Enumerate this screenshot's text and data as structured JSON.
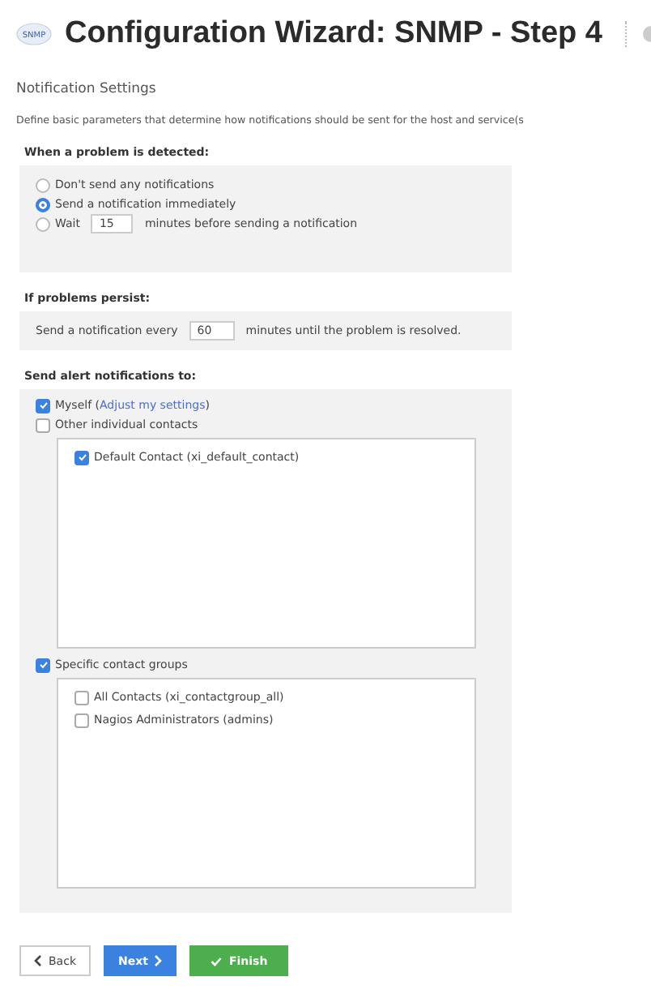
{
  "header": {
    "logo": "SNMP",
    "title": "Configuration Wizard: SNMP - Step 4"
  },
  "section_title": "Notification Settings",
  "description": "Define basic parameters that determine how notifications should be sent for the host and service(s",
  "problem_detected": {
    "heading": "When a problem is detected:",
    "options": [
      {
        "kind": "text",
        "label": "Don't send any notifications",
        "selected": false
      },
      {
        "kind": "text",
        "label": "Send a notification immediately",
        "selected": true
      },
      {
        "kind": "wait",
        "before": "Wait",
        "value": "15",
        "after": "minutes before sending a notification",
        "selected": false
      }
    ]
  },
  "problems_persist": {
    "heading": "If problems persist:",
    "before": "Send a notification every",
    "value": "60",
    "after": "minutes until the problem is resolved."
  },
  "alerts": {
    "heading": "Send alert notifications to:",
    "myself": {
      "label": "Myself (",
      "link": "Adjust my settings",
      "suffix": ")",
      "checked": true
    },
    "groups": [
      {
        "label": "Other individual contacts",
        "checked": false,
        "items": [
          {
            "label": "Default Contact (xi_default_contact)",
            "checked": true
          }
        ]
      },
      {
        "label": "Specific contact groups",
        "checked": true,
        "items": [
          {
            "label": "All Contacts (xi_contactgroup_all)",
            "checked": false
          },
          {
            "label": "Nagios Administrators (admins)",
            "checked": false
          }
        ]
      }
    ]
  },
  "buttons": [
    {
      "kind": "back",
      "label": "Back"
    },
    {
      "kind": "next",
      "label": "Next"
    },
    {
      "kind": "finish",
      "label": "Finish"
    }
  ]
}
